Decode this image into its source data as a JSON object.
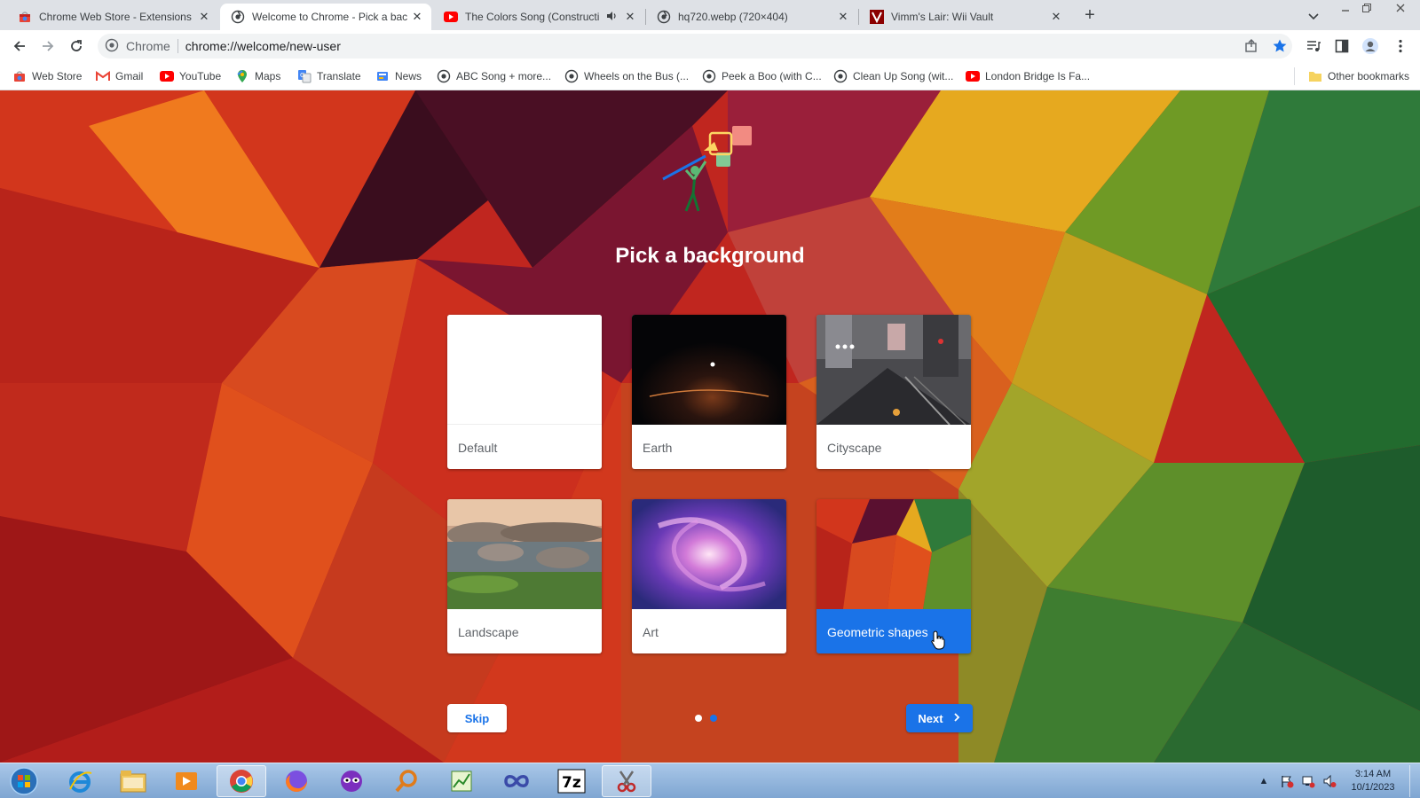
{
  "tabs": [
    {
      "title": "Chrome Web Store - Extensions",
      "favicon": "chrome-web-store-icon",
      "active": false
    },
    {
      "title": "Welcome to Chrome - Pick a bac",
      "favicon": "globe-icon",
      "active": true
    },
    {
      "title": "The Colors Song (Constructi",
      "favicon": "youtube-icon",
      "active": false,
      "audio": true
    },
    {
      "title": "hq720.webp (720×404)",
      "favicon": "globe-icon",
      "active": false
    },
    {
      "title": "Vimm's Lair: Wii Vault",
      "favicon": "vimm-icon",
      "active": false
    }
  ],
  "toolbar": {
    "site_label": "Chrome",
    "url": "chrome://welcome/new-user"
  },
  "bookmarks": [
    {
      "label": "Web Store",
      "icon": "chrome-web-store-icon"
    },
    {
      "label": "Gmail",
      "icon": "gmail-icon"
    },
    {
      "label": "YouTube",
      "icon": "youtube-icon"
    },
    {
      "label": "Maps",
      "icon": "maps-icon"
    },
    {
      "label": "Translate",
      "icon": "translate-icon"
    },
    {
      "label": "News",
      "icon": "news-icon"
    },
    {
      "label": "ABC Song + more...",
      "icon": "globe-icon"
    },
    {
      "label": "Wheels on the Bus (...",
      "icon": "globe-icon"
    },
    {
      "label": "Peek a Boo (with C...",
      "icon": "globe-icon"
    },
    {
      "label": "Clean Up Song (wit...",
      "icon": "globe-icon"
    },
    {
      "label": "London Bridge Is Fa...",
      "icon": "youtube-icon"
    }
  ],
  "other_bookmarks": "Other bookmarks",
  "page": {
    "heading": "Pick a background",
    "cards": [
      {
        "label": "Default",
        "selected": false
      },
      {
        "label": "Earth",
        "selected": false
      },
      {
        "label": "Cityscape",
        "selected": false
      },
      {
        "label": "Landscape",
        "selected": false
      },
      {
        "label": "Art",
        "selected": false
      },
      {
        "label": "Geometric shapes",
        "selected": true
      }
    ],
    "skip_label": "Skip",
    "next_label": "Next",
    "step_current": 1,
    "step_total": 2,
    "colors": {
      "accent": "#1a73e8"
    }
  },
  "taskbar": {
    "apps": [
      "start-orb-icon",
      "internet-explorer-icon",
      "file-explorer-icon",
      "media-player-icon",
      "chrome-icon",
      "firefox-icon",
      "mask-app-icon",
      "search-app-icon",
      "chart-app-icon",
      "infinity-app-icon",
      "7zip-icon",
      "snipping-tool-icon"
    ],
    "time": "3:14 AM",
    "date": "10/1/2023"
  }
}
